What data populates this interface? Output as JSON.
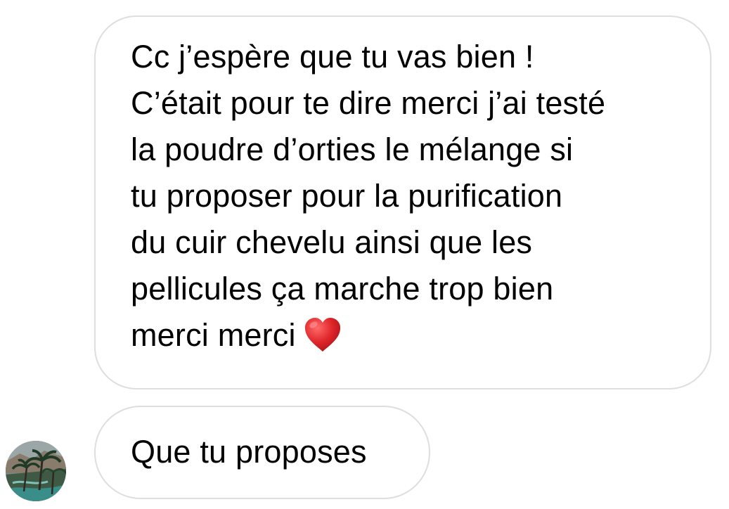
{
  "messages": [
    {
      "lines": [
        "Cc j’espère que tu vas bien !",
        "C’était pour te dire merci j’ai testé",
        "la poudre d’orties le mélange si",
        "tu proposer pour la purification",
        "du cuir chevelu ainsi que les",
        "pellicules ça marche trop bien",
        "merci merci"
      ],
      "emoji": "red-heart-icon"
    },
    {
      "text": "Que tu proposes"
    }
  ],
  "avatar": {
    "icon": "palm-trees-landscape-icon"
  },
  "colors": {
    "bubble_border": "#dedede",
    "text": "#000000",
    "heart": "#e0282c",
    "background": "#ffffff"
  }
}
